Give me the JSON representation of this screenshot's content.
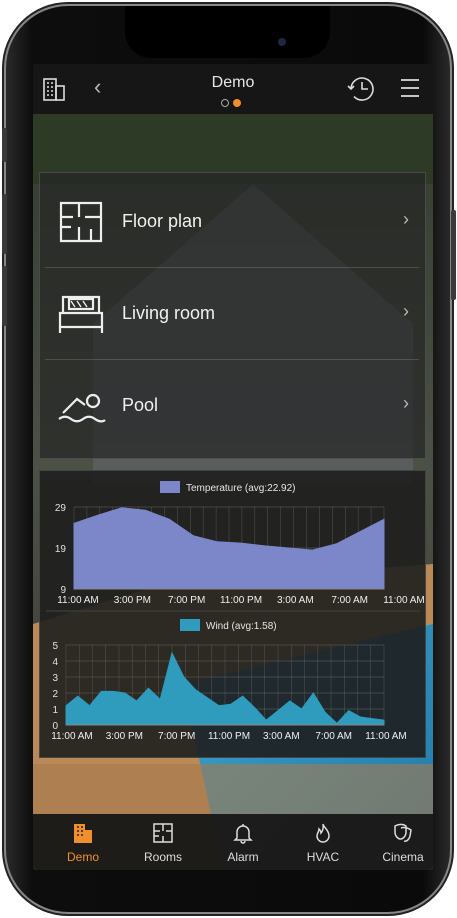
{
  "header": {
    "title": "Demo",
    "page_dots": 2,
    "active_dot": 2
  },
  "icons": {
    "building": "building-icon",
    "back": "chevron-left-icon",
    "history": "clock-history-icon",
    "menu": "hamburger-icon"
  },
  "menu_items": [
    {
      "label": "Floor plan",
      "icon": "floor-plan-icon"
    },
    {
      "label": "Living room",
      "icon": "bed-icon"
    },
    {
      "label": "Pool",
      "icon": "swimmer-icon"
    }
  ],
  "chevron": "›",
  "colors": {
    "accent": "#f0902d",
    "temperature": "#7b87c9",
    "wind": "#2f9bbd"
  },
  "chart_data": [
    {
      "type": "area",
      "legend": "Temperature (avg:22.92)",
      "x": [
        "11:00 AM",
        "3:00 PM",
        "7:00 PM",
        "11:00 PM",
        "3:00 AM",
        "7:00 AM",
        "11:00 AM"
      ],
      "yticks": [
        9,
        19,
        29
      ],
      "ylim": [
        9,
        29
      ],
      "values": [
        25,
        27,
        28.8,
        28.2,
        26,
        22,
        20.5,
        20.2,
        19.5,
        19,
        18.5,
        20,
        23,
        26
      ],
      "grid": true
    },
    {
      "type": "area",
      "legend": "Wind (avg:1.58)",
      "x": [
        "11:00 AM",
        "3:00 PM",
        "7:00 PM",
        "11:00 PM",
        "3:00 AM",
        "7:00 AM",
        "11:00 AM"
      ],
      "yticks": [
        0,
        1,
        2,
        3,
        4,
        5
      ],
      "ylim": [
        0,
        5
      ],
      "values": [
        1.2,
        1.8,
        1.2,
        2.1,
        2.1,
        2.0,
        1.5,
        2.3,
        1.6,
        4.5,
        3.0,
        2.2,
        1.7,
        1.2,
        1.3,
        1.8,
        1.1,
        0.3,
        0.9,
        1.5,
        1.0,
        2.0,
        0.8,
        0.1,
        0.9,
        0.5,
        0.4,
        0.3
      ],
      "grid": true
    }
  ],
  "nav": [
    {
      "label": "Demo",
      "icon": "building-icon",
      "active": true
    },
    {
      "label": "Rooms",
      "icon": "floor-plan-icon",
      "active": false
    },
    {
      "label": "Alarm",
      "icon": "bell-icon",
      "active": false
    },
    {
      "label": "HVAC",
      "icon": "flame-icon",
      "active": false
    },
    {
      "label": "Cinema",
      "icon": "theater-masks-icon",
      "active": false
    }
  ]
}
